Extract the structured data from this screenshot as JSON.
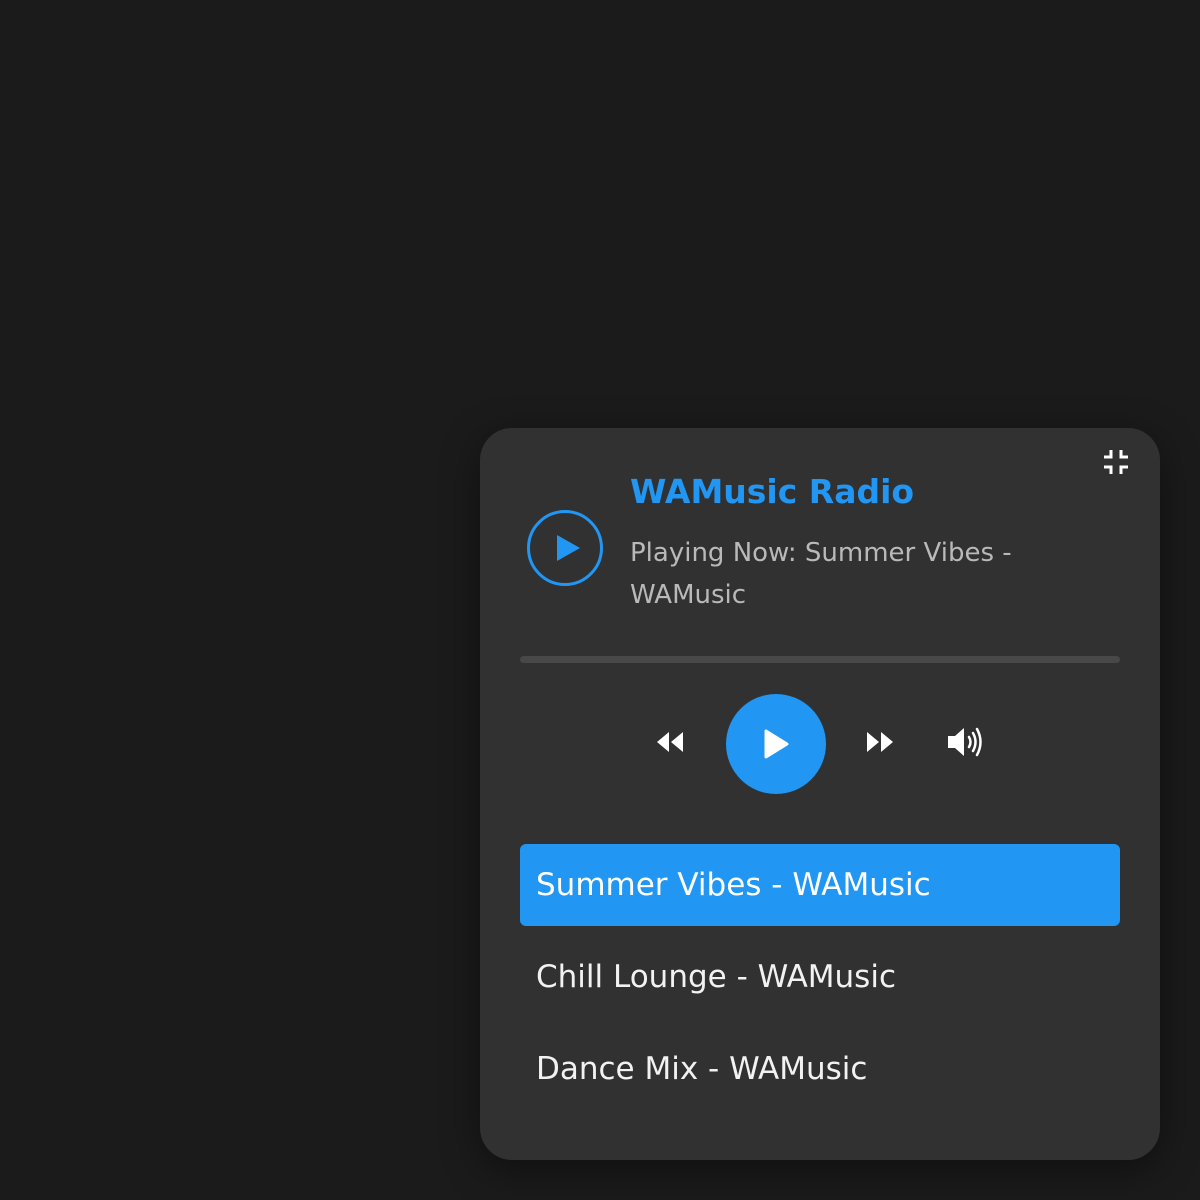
{
  "colors": {
    "background": "#1b1b1b",
    "panel": "#313131",
    "accent": "#2196f3",
    "text": "#f2f2f2",
    "muted_text": "#b9b9b9",
    "track": "#484848"
  },
  "player": {
    "title": "WAMusic Radio",
    "now_playing": "Playing Now: Summer Vibes - WAMusic",
    "progress": 0,
    "icons": {
      "minimize": "minimize-icon",
      "big_play": "play-icon",
      "rewind": "rewind-icon",
      "play": "play-icon",
      "forward": "fast-forward-icon",
      "volume": "volume-icon"
    }
  },
  "playlist": {
    "active_index": 0,
    "items": [
      {
        "label": "Summer Vibes - WAMusic"
      },
      {
        "label": "Chill Lounge - WAMusic"
      },
      {
        "label": "Dance Mix - WAMusic"
      }
    ]
  }
}
